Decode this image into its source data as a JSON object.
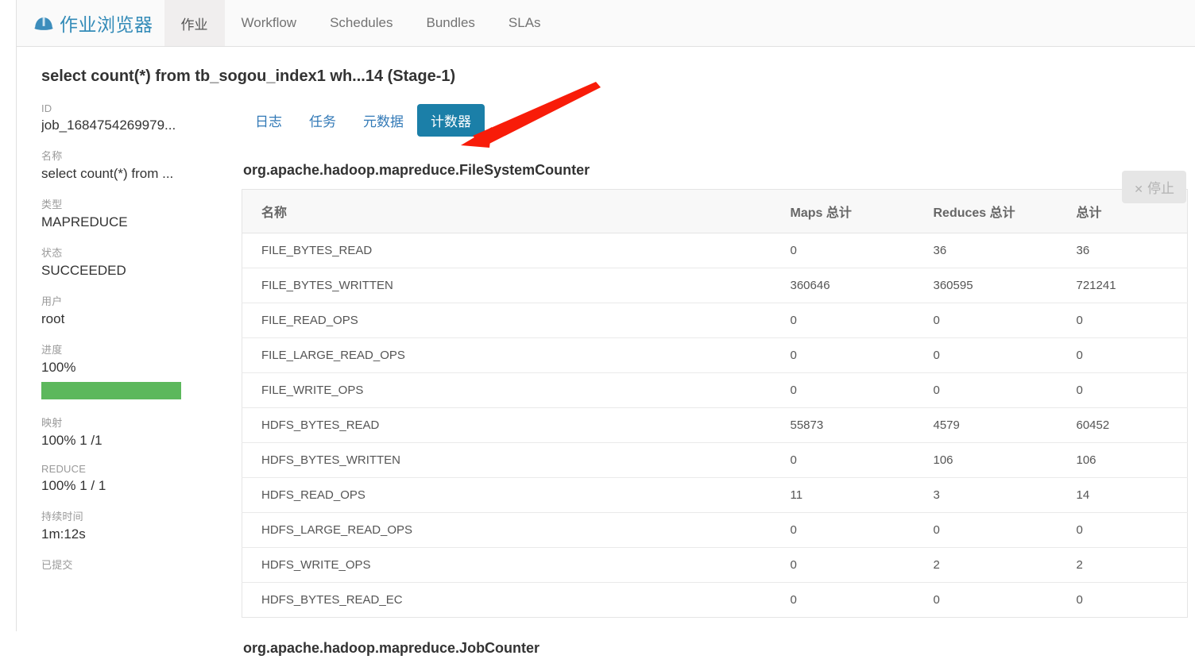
{
  "navbar": {
    "brand_label": "作业浏览器",
    "brand_icon": "helmet-icon",
    "items": [
      {
        "label": "作业",
        "active": true
      },
      {
        "label": "Workflow",
        "active": false
      },
      {
        "label": "Schedules",
        "active": false
      },
      {
        "label": "Bundles",
        "active": false
      },
      {
        "label": "SLAs",
        "active": false
      }
    ]
  },
  "page": {
    "title": "select count(*) from tb_sogou_index1 wh...14 (Stage-1)"
  },
  "details": [
    {
      "label": "ID",
      "value": "job_1684754269979..."
    },
    {
      "label": "名称",
      "value": "select count(*) from ..."
    },
    {
      "label": "类型",
      "value": "MAPREDUCE"
    },
    {
      "label": "状态",
      "value": "SUCCEEDED"
    },
    {
      "label": "用户",
      "value": "root"
    },
    {
      "label": "进度",
      "value": "100%"
    },
    {
      "label": "映射",
      "value": "100% 1 /1"
    },
    {
      "label": "REDUCE",
      "value": "100% 1 / 1"
    },
    {
      "label": "持续时间",
      "value": "1m:12s"
    },
    {
      "label": "已提交",
      "value": ""
    }
  ],
  "progress": {
    "percent_label": "100%",
    "percent": 100,
    "color": "#5cb85c"
  },
  "tabs": [
    {
      "label": "日志",
      "active": false
    },
    {
      "label": "任务",
      "active": false
    },
    {
      "label": "元数据",
      "active": false
    },
    {
      "label": "计数器",
      "active": true
    }
  ],
  "stop_button": {
    "label": "停止",
    "icon": "close-icon",
    "glyph": "✕",
    "disabled": true
  },
  "sections": [
    {
      "heading": "org.apache.hadoop.mapreduce.FileSystemCounter",
      "columns": [
        "名称",
        "Maps 总计",
        "Reduces 总计",
        "总计"
      ],
      "rows": [
        {
          "name": "FILE_BYTES_READ",
          "maps": "0",
          "reduces": "36",
          "total": "36"
        },
        {
          "name": "FILE_BYTES_WRITTEN",
          "maps": "360646",
          "reduces": "360595",
          "total": "721241"
        },
        {
          "name": "FILE_READ_OPS",
          "maps": "0",
          "reduces": "0",
          "total": "0"
        },
        {
          "name": "FILE_LARGE_READ_OPS",
          "maps": "0",
          "reduces": "0",
          "total": "0"
        },
        {
          "name": "FILE_WRITE_OPS",
          "maps": "0",
          "reduces": "0",
          "total": "0"
        },
        {
          "name": "HDFS_BYTES_READ",
          "maps": "55873",
          "reduces": "4579",
          "total": "60452"
        },
        {
          "name": "HDFS_BYTES_WRITTEN",
          "maps": "0",
          "reduces": "106",
          "total": "106"
        },
        {
          "name": "HDFS_READ_OPS",
          "maps": "11",
          "reduces": "3",
          "total": "14"
        },
        {
          "name": "HDFS_LARGE_READ_OPS",
          "maps": "0",
          "reduces": "0",
          "total": "0"
        },
        {
          "name": "HDFS_WRITE_OPS",
          "maps": "0",
          "reduces": "2",
          "total": "2"
        },
        {
          "name": "HDFS_BYTES_READ_EC",
          "maps": "0",
          "reduces": "0",
          "total": "0"
        }
      ]
    },
    {
      "heading": "org.apache.hadoop.mapreduce.JobCounter",
      "columns": [],
      "rows": []
    }
  ],
  "annotation": {
    "type": "arrow",
    "color": "#f81c09"
  },
  "colors": {
    "brand_blue": "#338bb8",
    "link_blue": "#337ab7",
    "active_tab_blue": "#1b7fa8",
    "progress_green": "#5cb85c",
    "annotation_red": "#f81c09"
  }
}
